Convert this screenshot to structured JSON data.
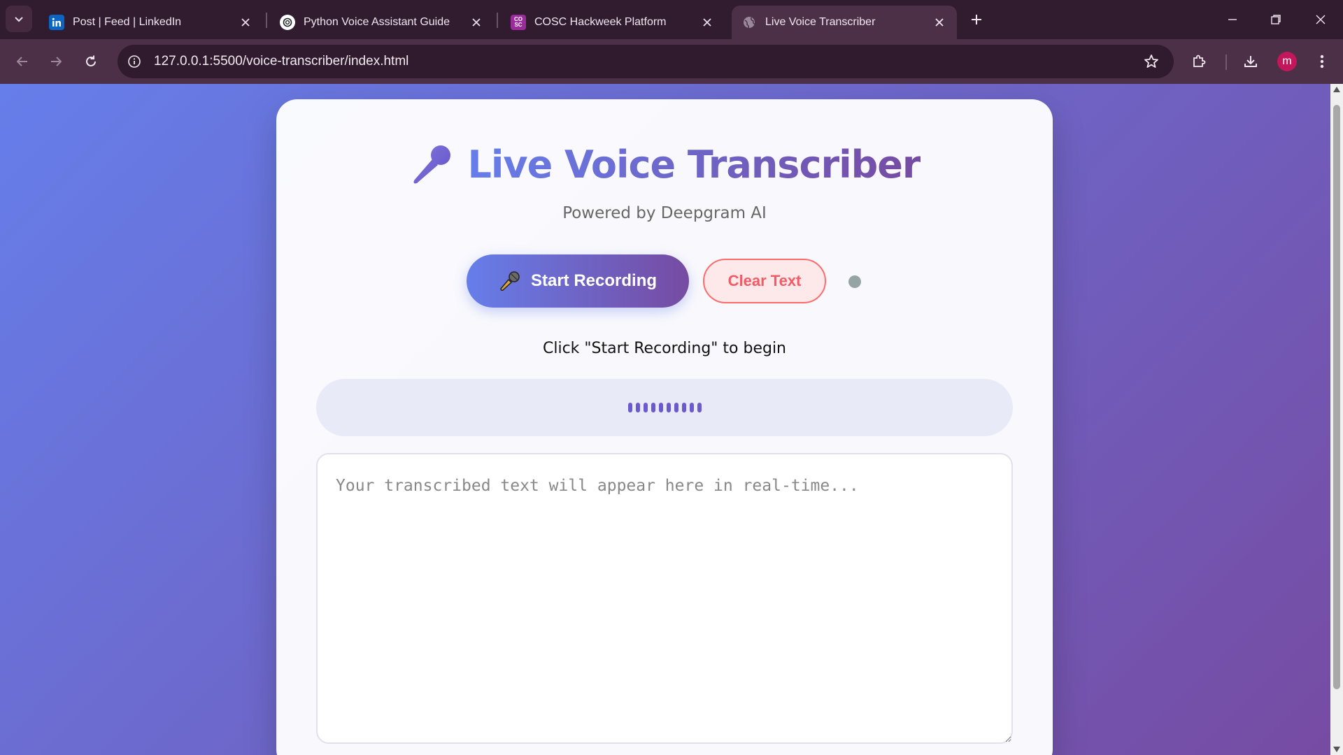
{
  "browser": {
    "tabs": [
      {
        "title": "Post | Feed | LinkedIn",
        "favicon": "linkedin-icon",
        "active": false
      },
      {
        "title": "Python Voice Assistant Guide",
        "favicon": "openai-icon",
        "active": false
      },
      {
        "title": "COSC Hackweek Platform",
        "favicon": "cosc-icon",
        "active": false
      },
      {
        "title": "Live Voice Transcriber",
        "favicon": "globe-icon",
        "active": true
      }
    ],
    "cosc_favicon_text": "CO SC",
    "url": "127.0.0.1:5500/voice-transcriber/index.html",
    "profile_initial": "m"
  },
  "app": {
    "title": "Live Voice Transcriber",
    "subtitle": "Powered by Deepgram AI",
    "start_button_label": "Start Recording",
    "clear_button_label": "Clear Text",
    "status_message": "Click \"Start Recording\" to begin",
    "transcript_placeholder": "Your transcribed text will appear here in real-time...",
    "transcript_value": "",
    "visualizer_bar_count": 10,
    "colors": {
      "gradient_start": "#667eea",
      "gradient_end": "#764ba2",
      "clear_button": "#ff6b6b",
      "status_idle": "#95a5a6"
    }
  }
}
